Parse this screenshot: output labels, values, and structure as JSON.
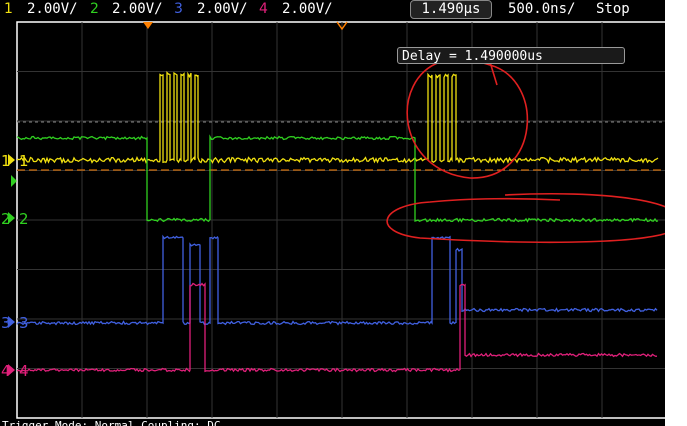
{
  "channels": [
    {
      "num": "1",
      "scale": "2.00V/",
      "color": "#f0e010"
    },
    {
      "num": "2",
      "scale": "2.00V/",
      "color": "#30d020"
    },
    {
      "num": "3",
      "scale": "2.00V/",
      "color": "#4060e0"
    },
    {
      "num": "4",
      "scale": "2.00V/",
      "color": "#e0207a"
    }
  ],
  "timebase": {
    "delay": "1.490µs",
    "scale": "500.0ns/",
    "status": "Stop"
  },
  "delay_readout": "Delay = 1.490000us",
  "bottom_text": "Trigger Mode: Normal  Coupling: DC"
}
